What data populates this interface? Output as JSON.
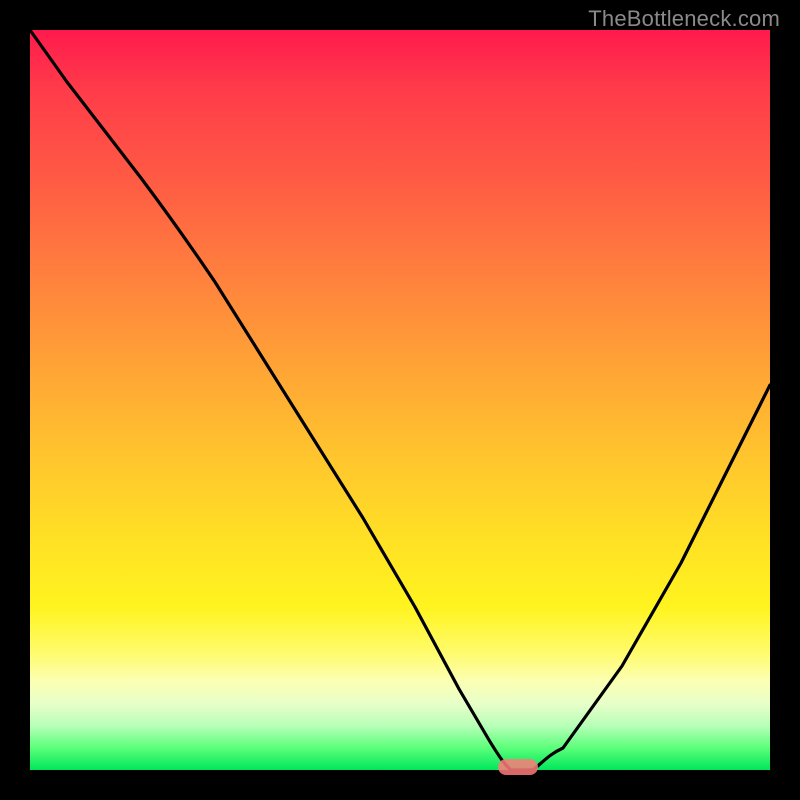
{
  "watermark": "TheBottleneck.com",
  "colors": {
    "frame": "#000000",
    "curve": "#000000",
    "marker": "#ff7a7a",
    "gradient_top": "#ff1a4d",
    "gradient_bottom": "#00e65c"
  },
  "chart_data": {
    "type": "line",
    "title": "",
    "xlabel": "",
    "ylabel": "",
    "xlim": [
      0,
      100
    ],
    "ylim": [
      0,
      100
    ],
    "legend": false,
    "grid": false,
    "series": [
      {
        "name": "bottleneck-curve",
        "x": [
          0,
          5,
          15,
          25,
          35,
          45,
          52,
          58,
          62,
          65,
          68,
          72,
          80,
          88,
          95,
          100
        ],
        "values": [
          100,
          93,
          80,
          66,
          50,
          34,
          22,
          11,
          4,
          0,
          0,
          3,
          14,
          28,
          42,
          52
        ]
      }
    ],
    "annotations": [
      {
        "name": "optimal-marker",
        "shape": "pill",
        "x": 66,
        "y": 0,
        "color": "#ff7a7a"
      }
    ]
  }
}
